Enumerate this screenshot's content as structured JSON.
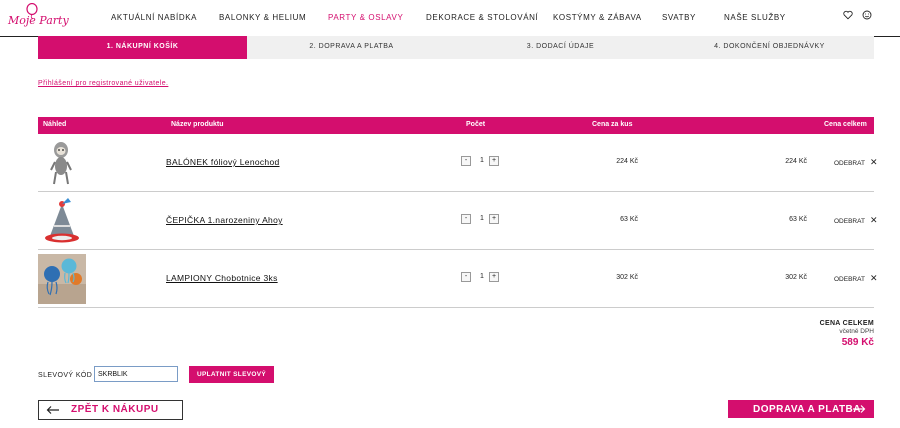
{
  "brand": {
    "logo_text": "Moje Party",
    "accent_color": "#d40e6e"
  },
  "nav": {
    "items": [
      {
        "label": "AKTUÁLNÍ NABÍDKA",
        "active": false
      },
      {
        "label": "BALONKY & HELIUM",
        "active": false
      },
      {
        "label": "PARTY & OSLAVY",
        "active": true
      },
      {
        "label": "DEKORACE & STOLOVÁNÍ",
        "active": false
      },
      {
        "label": "KOSTÝMY & ZÁBAVA",
        "active": false
      },
      {
        "label": "SVATBY",
        "active": false
      },
      {
        "label": "NAŠE SLUŽBY",
        "active": false
      }
    ],
    "icons": [
      "heart-icon",
      "user-icon"
    ]
  },
  "steps": [
    {
      "label": "1. NÁKUPNÍ KOŠÍK",
      "active": true
    },
    {
      "label": "2. DOPRAVA A PLATBA",
      "active": false
    },
    {
      "label": "3. DODACÍ ÚDAJE",
      "active": false
    },
    {
      "label": "4. DOKONČENÍ OBJEDNÁVKY",
      "active": false
    }
  ],
  "login_link": "Přihlášení pro registrované uživatele.",
  "table": {
    "headers": {
      "preview": "Náhled",
      "product": "Název produktu",
      "quantity": "Počet",
      "unit_price": "Cena za kus",
      "total": "Cena celkem"
    },
    "rows": [
      {
        "name": "BALÓNEK fóliový Lenochod",
        "qty": "1",
        "unit_price": "224 Kč",
        "total": "224 Kč",
        "remove": "ODEBRAT",
        "thumb": "sloth-balloon"
      },
      {
        "name": "ČEPIČKA 1.narozeniny Ahoy",
        "qty": "1",
        "unit_price": "63 Kč",
        "total": "63 Kč",
        "remove": "ODEBRAT",
        "thumb": "party-hat"
      },
      {
        "name": "LAMPIONY Chobotnice 3ks",
        "qty": "1",
        "unit_price": "302 Kč",
        "total": "302 Kč",
        "remove": "ODEBRAT",
        "thumb": "octopus-lanterns"
      }
    ],
    "qty_minus": "-",
    "qty_plus": "+"
  },
  "totals": {
    "label": "CENA CELKEM",
    "vat_note": "včetně DPH",
    "price": "589 Kč"
  },
  "voucher": {
    "label": "SLEVOVÝ KÓD",
    "value": "SKRBLÍK",
    "button": "UPLATNIT SLEVOVÝ KÓD"
  },
  "buttons": {
    "back": "ZPĚT K NÁKUPU",
    "next": "DOPRAVA A PLATBA"
  }
}
